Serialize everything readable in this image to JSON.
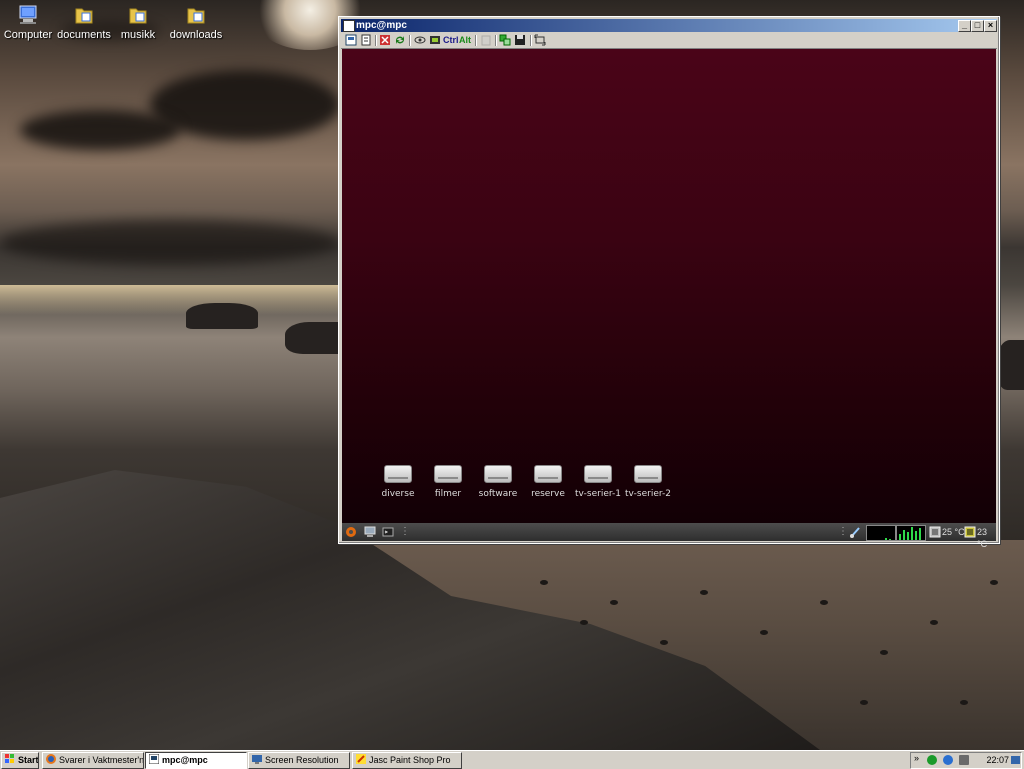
{
  "desktop": {
    "icons": [
      {
        "label": "Computer",
        "icon": "computer-icon"
      },
      {
        "label": "documents",
        "icon": "folder-icon"
      },
      {
        "label": "musikk",
        "icon": "folder-icon"
      },
      {
        "label": "downloads",
        "icon": "folder-icon"
      }
    ]
  },
  "vnc_window": {
    "title": "mpc@mpc",
    "controls": {
      "minimize": "_",
      "maximize": "□",
      "close": "×"
    },
    "toolbar": {
      "ctrl_label": "Ctrl",
      "alt_label": "Alt",
      "tools": [
        "connection-options-icon",
        "connection-info-icon",
        "fullscreen-icon",
        "refresh-icon",
        "send-ctrl-alt-del-icon",
        "send-start-icon",
        "ctrl-key-icon",
        "alt-key-icon",
        "clipboard-icon",
        "transfer-icon",
        "save-icon",
        "scale-icon"
      ]
    },
    "remote_desktop": {
      "drives": [
        "diverse",
        "filmer",
        "software",
        "reserve",
        "tv-serier-1",
        "tv-serier-2"
      ],
      "panel": {
        "cpu_temp": "25 °C",
        "hdd_temp": "23 °C",
        "graph_color": "#2fd94a"
      }
    }
  },
  "taskbar": {
    "start_label": "Start",
    "buttons": [
      {
        "label": "Svarer i Vaktmester'n...",
        "icon": "firefox-icon",
        "active": false
      },
      {
        "label": "mpc@mpc",
        "icon": "vnc-icon",
        "active": true
      },
      {
        "label": "Screen Resolution",
        "icon": "display-icon",
        "active": false
      },
      {
        "label": "Jasc Paint Shop Pro",
        "icon": "paintshop-icon",
        "active": false
      }
    ],
    "tray": {
      "time": "22:07",
      "icons": [
        "show-hidden-icon",
        "utorrent-icon",
        "network-icon",
        "sound-icon"
      ]
    }
  },
  "colors": {
    "remote_bg_top": "#4a0418",
    "remote_bg_bottom": "#120005",
    "titlebar_start": "#0a246a",
    "titlebar_end": "#a6caf0"
  }
}
